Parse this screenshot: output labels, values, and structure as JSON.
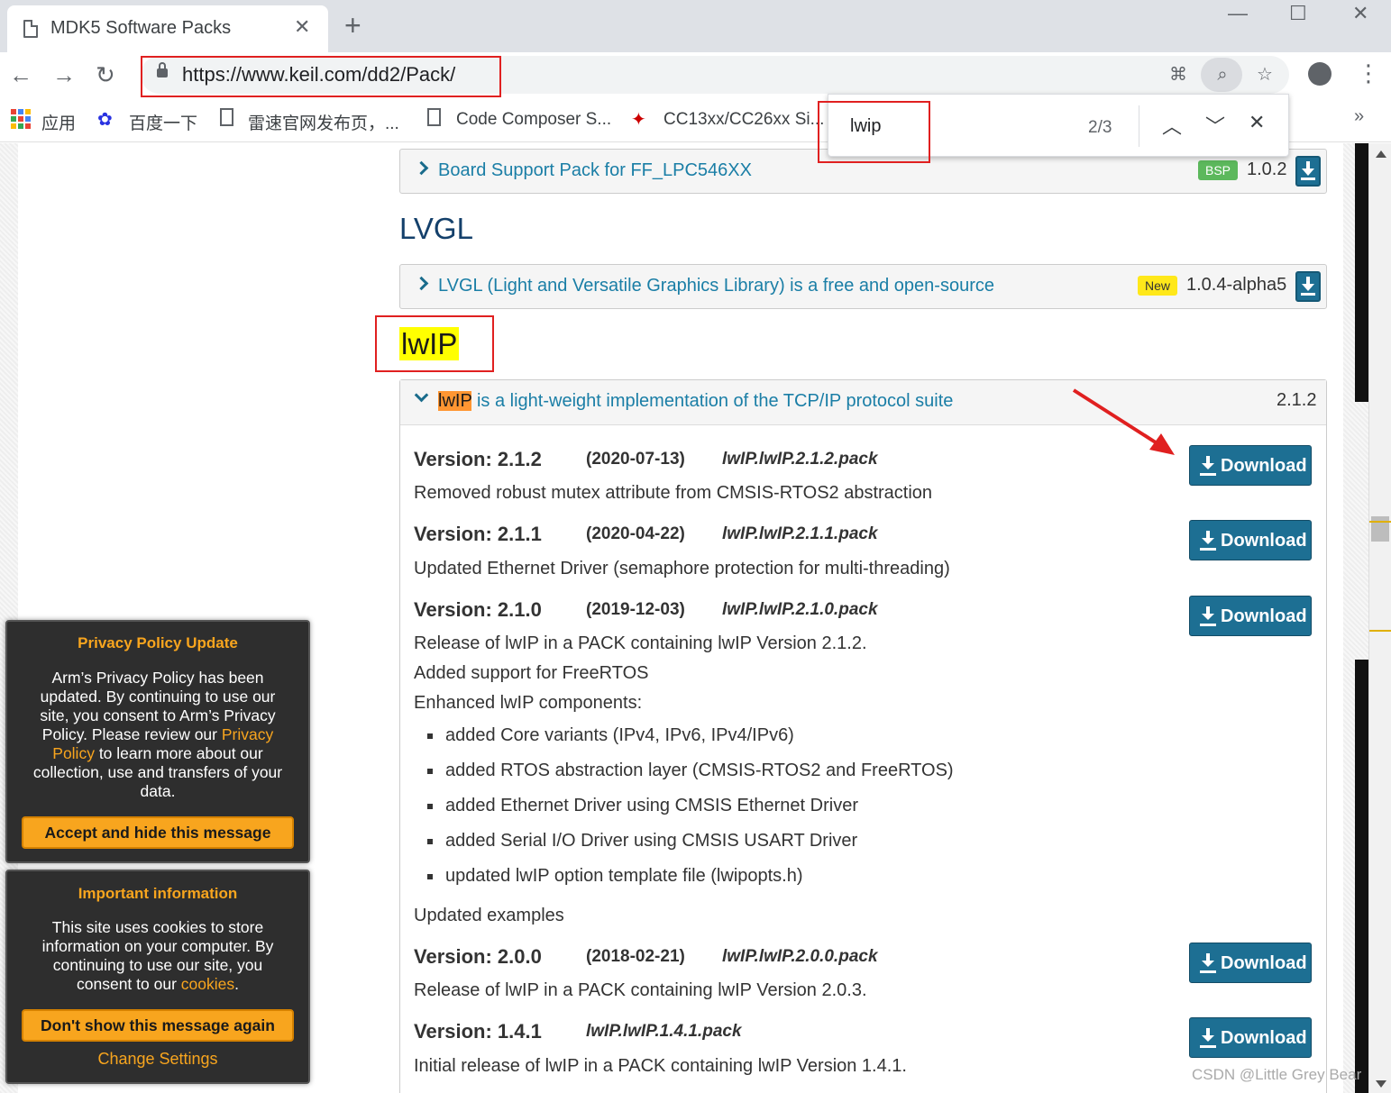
{
  "tab": {
    "title": "MDK5 Software Packs",
    "close": "✕",
    "new_tab": "+"
  },
  "window_controls": {
    "minimize": "—",
    "maximize": "☐",
    "close": "✕"
  },
  "toolbar": {
    "url": "https://www.keil.com/dd2/Pack/"
  },
  "bookmarks": {
    "items": [
      {
        "label": "应用"
      },
      {
        "label": "百度一下"
      },
      {
        "label": "雷速官网发布页，..."
      },
      {
        "label": "Code Composer S..."
      },
      {
        "label": "CC13xx/CC26xx Si..."
      }
    ],
    "more": "»"
  },
  "find_bar": {
    "query": "lwip",
    "count": "2/3"
  },
  "packs": {
    "bsp": {
      "text": "Board Support Pack for FF_LPC546XX",
      "badge": "BSP",
      "version": "1.0.2"
    },
    "lvgl_heading": "LVGL",
    "lvgl": {
      "text": "LVGL (Light and Versatile Graphics Library) is a free and open-source",
      "badge": "New",
      "version": "1.0.4-alpha5"
    },
    "lwip_heading": "lwIP",
    "lwip": {
      "name": "lwIP",
      "text": " is a light-weight implementation of the TCP/IP protocol suite",
      "version": "2.1.2",
      "download_label": "Download",
      "releases": [
        {
          "title": "Version: 2.1.2",
          "date": "(2020-07-13)",
          "file": "lwIP.lwIP.2.1.2.pack",
          "lines": [
            "Removed robust mutex attribute from CMSIS-RTOS2 abstraction"
          ]
        },
        {
          "title": "Version: 2.1.1",
          "date": "(2020-04-22)",
          "file": "lwIP.lwIP.2.1.1.pack",
          "lines": [
            "Updated Ethernet Driver (semaphore protection for multi-threading)"
          ]
        },
        {
          "title": "Version: 2.1.0",
          "date": "(2019-12-03)",
          "file": "lwIP.lwIP.2.1.0.pack",
          "lines": [
            "Release of lwIP in a PACK containing lwIP Version 2.1.2.",
            "Added support for FreeRTOS",
            "Enhanced lwIP components:"
          ],
          "bullets": [
            "added Core variants (IPv4, IPv6, IPv4/IPv6)",
            "added RTOS abstraction layer (CMSIS-RTOS2 and FreeRTOS)",
            "added Ethernet Driver using CMSIS Ethernet Driver",
            "added Serial I/O Driver using CMSIS USART Driver",
            "updated lwIP option template file (lwipopts.h)"
          ],
          "after": "Updated examples"
        },
        {
          "title": "Version: 2.0.0",
          "date": "(2018-02-21)",
          "file": "lwIP.lwIP.2.0.0.pack",
          "lines": [
            "Release of lwIP in a PACK containing lwIP Version 2.0.3."
          ]
        },
        {
          "title": "Version: 1.4.1",
          "date": "",
          "file": "lwIP.lwIP.1.4.1.pack",
          "lines": [
            "Initial release of lwIP in a PACK containing lwIP Version 1.4.1."
          ]
        }
      ]
    }
  },
  "privacy_popup": {
    "title": "Privacy Policy Update",
    "body_1": "Arm’s Privacy Policy has been updated. By continuing to use our site, you consent to Arm’s Privacy Policy. Please review our ",
    "link": "Privacy Policy",
    "body_2": " to learn more about our collection, use and transfers of your data.",
    "button": "Accept and hide this message"
  },
  "cookie_popup": {
    "title": "Important information",
    "body_1": "This site uses cookies to store information on your computer. By continuing to use our site, you consent to our ",
    "link": "cookies",
    "body_2": ".",
    "button": "Don't show this message again",
    "settings": "Change Settings"
  },
  "watermark": "CSDN @Little Grey Bear",
  "colors": {
    "accent": "#1d6f93",
    "link": "#1a7ea6",
    "highlight": "#ffff00",
    "find_active": "#ff9632",
    "popup_accent": "#f8a51e",
    "annotation": "#e02020"
  }
}
